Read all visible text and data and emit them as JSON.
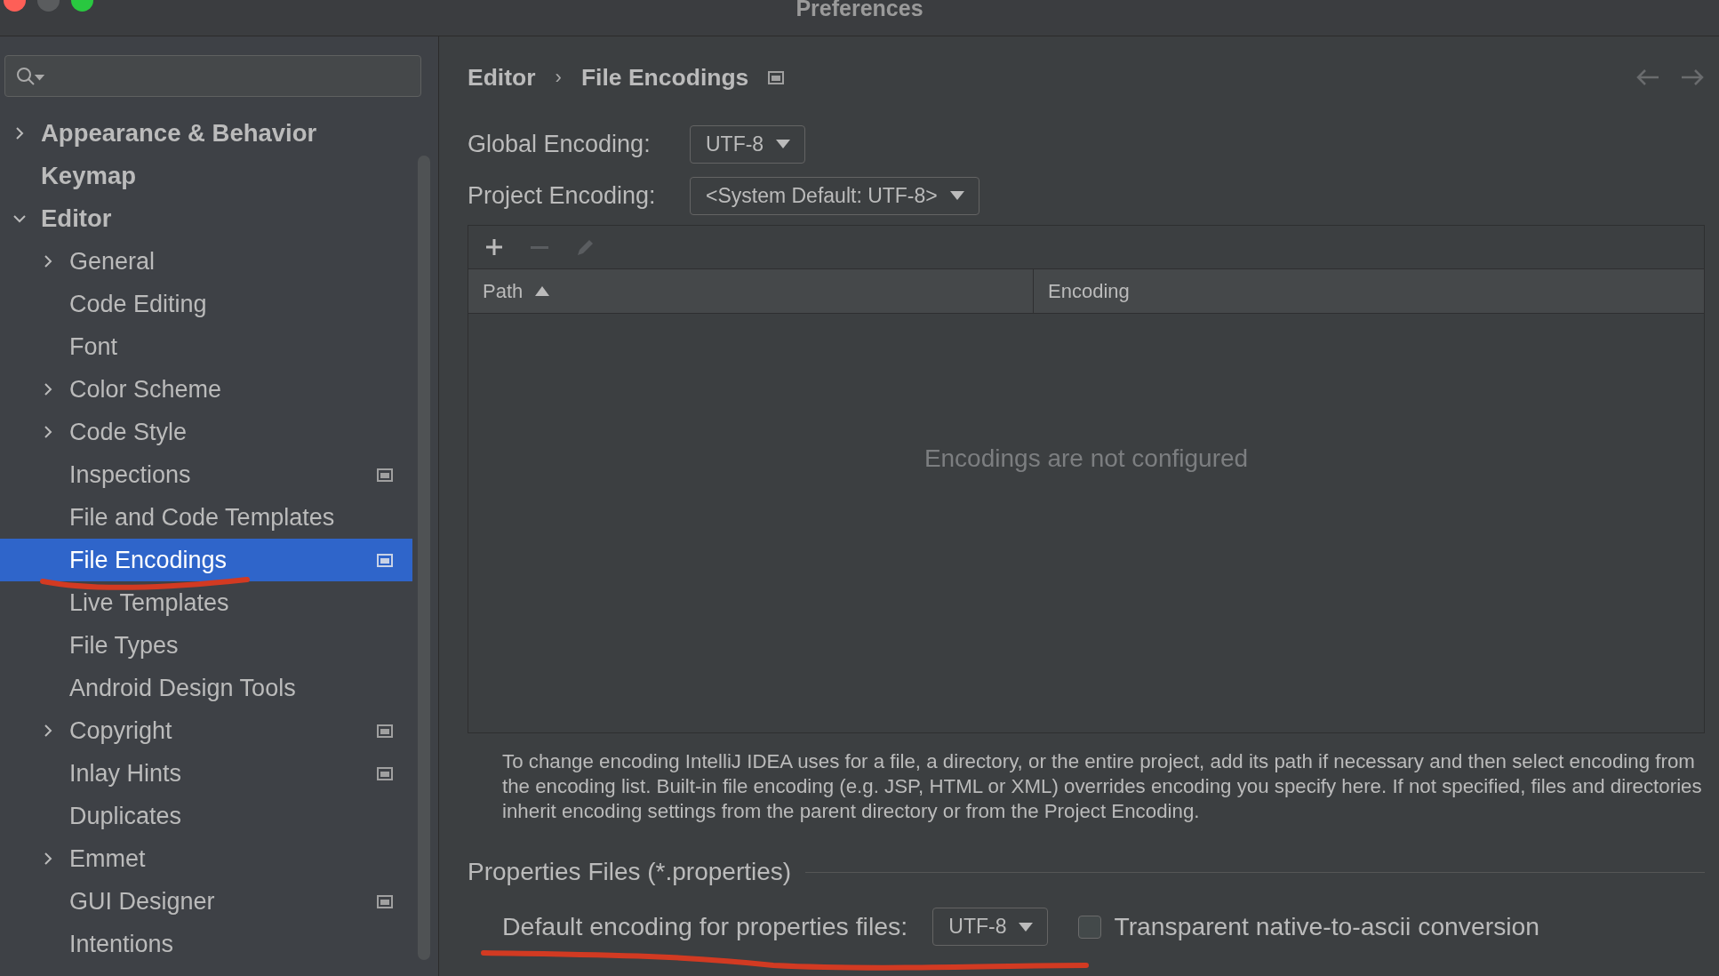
{
  "window": {
    "title": "Preferences"
  },
  "sidebar": {
    "items": [
      {
        "label": "Appearance & Behavior",
        "expanded": false,
        "selected": false,
        "scoped": false
      },
      {
        "label": "Keymap",
        "selected": false,
        "scoped": false
      },
      {
        "label": "Editor",
        "expanded": true,
        "selected": false,
        "scoped": false,
        "children": [
          {
            "label": "General",
            "expanded": false,
            "selected": false,
            "scoped": false
          },
          {
            "label": "Code Editing",
            "selected": false,
            "scoped": false
          },
          {
            "label": "Font",
            "selected": false,
            "scoped": false
          },
          {
            "label": "Color Scheme",
            "expanded": false,
            "selected": false,
            "scoped": false
          },
          {
            "label": "Code Style",
            "expanded": false,
            "selected": false,
            "scoped": false
          },
          {
            "label": "Inspections",
            "selected": false,
            "scoped": true
          },
          {
            "label": "File and Code Templates",
            "selected": false,
            "scoped": false
          },
          {
            "label": "File Encodings",
            "selected": true,
            "scoped": true
          },
          {
            "label": "Live Templates",
            "selected": false,
            "scoped": false
          },
          {
            "label": "File Types",
            "selected": false,
            "scoped": false
          },
          {
            "label": "Android Design Tools",
            "selected": false,
            "scoped": false
          },
          {
            "label": "Copyright",
            "expanded": false,
            "selected": false,
            "scoped": true
          },
          {
            "label": "Inlay Hints",
            "selected": false,
            "scoped": true
          },
          {
            "label": "Duplicates",
            "selected": false,
            "scoped": false
          },
          {
            "label": "Emmet",
            "expanded": false,
            "selected": false,
            "scoped": false
          },
          {
            "label": "GUI Designer",
            "selected": false,
            "scoped": true
          },
          {
            "label": "Intentions",
            "selected": false,
            "scoped": false
          }
        ]
      }
    ]
  },
  "breadcrumb": {
    "parent": "Editor",
    "separator": "›",
    "current": "File Encodings",
    "scoped": true
  },
  "settings": [
    {
      "label": "Global Encoding:",
      "value": "UTF-8"
    },
    {
      "label": "Project Encoding:",
      "value": "<System Default: UTF-8>"
    }
  ],
  "table": {
    "toolbar": [
      {
        "kind": "add",
        "disabled": false
      },
      {
        "kind": "remove",
        "disabled": true
      },
      {
        "kind": "edit",
        "disabled": true
      }
    ],
    "columns": [
      {
        "label": "Path",
        "sort_ascending": true
      },
      {
        "label": "Encoding"
      }
    ],
    "empty_text": "Encodings are not configured"
  },
  "description": "To change encoding IntelliJ IDEA uses for a file, a directory, or the entire project, add its path if necessary and then select encoding from the encoding list. Built-in file encoding (e.g. JSP, HTML or XML) overrides encoding you specify here. If not specified, files and directories inherit encoding settings from the parent directory or from the Project Encoding.",
  "properties": {
    "title": "Properties Files (*.properties)",
    "label": "Default encoding for properties files:",
    "value": "UTF-8",
    "checkbox": {
      "label": "Transparent native-to-ascii conversion",
      "checked": false
    }
  },
  "annotations": {
    "sidebar_underline": true,
    "properties_underline": true
  }
}
